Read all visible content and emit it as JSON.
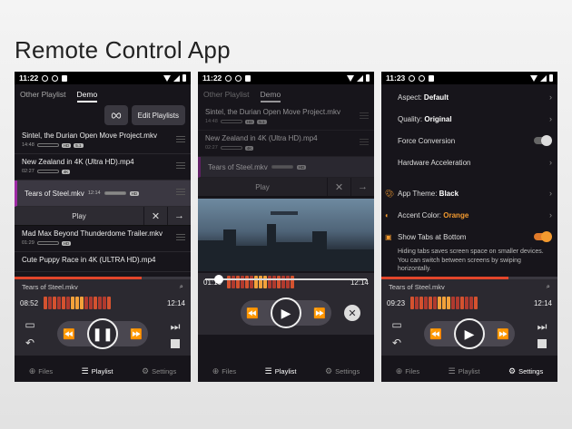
{
  "page_title": "Remote Control App",
  "colors": {
    "accent": "#f39a2f",
    "selection": "#9d2aa3",
    "progress": "#e2462b",
    "background": "#17151b"
  },
  "phone1": {
    "time": "11:22",
    "tabs": [
      "Other Playlist",
      "Demo"
    ],
    "edit_playlists": "Edit Playlists",
    "tracks": [
      {
        "name": "Sintel, the Durian Open Move Project.mkv",
        "duration": "14:48",
        "badges": [
          "HD",
          "5.1"
        ]
      },
      {
        "name": "New Zealand in 4K (Ultra HD).mp4",
        "duration": "02:27",
        "badges": [
          "4K"
        ]
      },
      {
        "name": "Tears of Steel.mkv",
        "duration": "12:14",
        "badges": [
          "HD"
        ]
      },
      {
        "name": "Mad Max Beyond Thunderdome Trailer.mkv",
        "duration": "01:29",
        "badges": [
          "HD"
        ]
      },
      {
        "name": "Cute Puppy Race in 4K (ULTRA HD).mp4",
        "duration": "",
        "badges": []
      }
    ],
    "play_label": "Play",
    "now_playing": "Tears of Steel.mkv",
    "elapsed": "08:52",
    "total": "12:14"
  },
  "phone2": {
    "time": "11:22",
    "tabs": [
      "Other Playlist",
      "Demo"
    ],
    "tracks": [
      {
        "name": "Sintel, the Durian Open Move Project.mkv",
        "duration": "14:48",
        "badges": [
          "HD",
          "5.1"
        ]
      },
      {
        "name": "New Zealand in 4K (Ultra HD).mp4",
        "duration": "02:27",
        "badges": [
          "4K"
        ]
      },
      {
        "name": "Tears of Steel.mkv",
        "duration": "",
        "badges": [
          "HD"
        ]
      }
    ],
    "play_label": "Play",
    "elapsed": "01:10",
    "total": "12:14"
  },
  "phone3": {
    "time": "11:23",
    "settings": {
      "aspect_label": "Aspect:",
      "aspect_value": "Default",
      "quality_label": "Quality:",
      "quality_value": "Original",
      "force_conversion": "Force Conversion",
      "hw_accel": "Hardware Acceleration",
      "theme_label": "App Theme:",
      "theme_value": "Black",
      "accent_label": "Accent Color:",
      "accent_value": "Orange",
      "tabs_bottom": "Show Tabs at Bottom",
      "tabs_bottom_desc": "Hiding tabs saves screen space on smaller devices. You can switch between screens by swiping horizontally."
    },
    "now_playing": "Tears of Steel.mkv",
    "elapsed": "09:23",
    "total": "12:14"
  },
  "nav": {
    "files": "Files",
    "playlist": "Playlist",
    "settings": "Settings"
  }
}
